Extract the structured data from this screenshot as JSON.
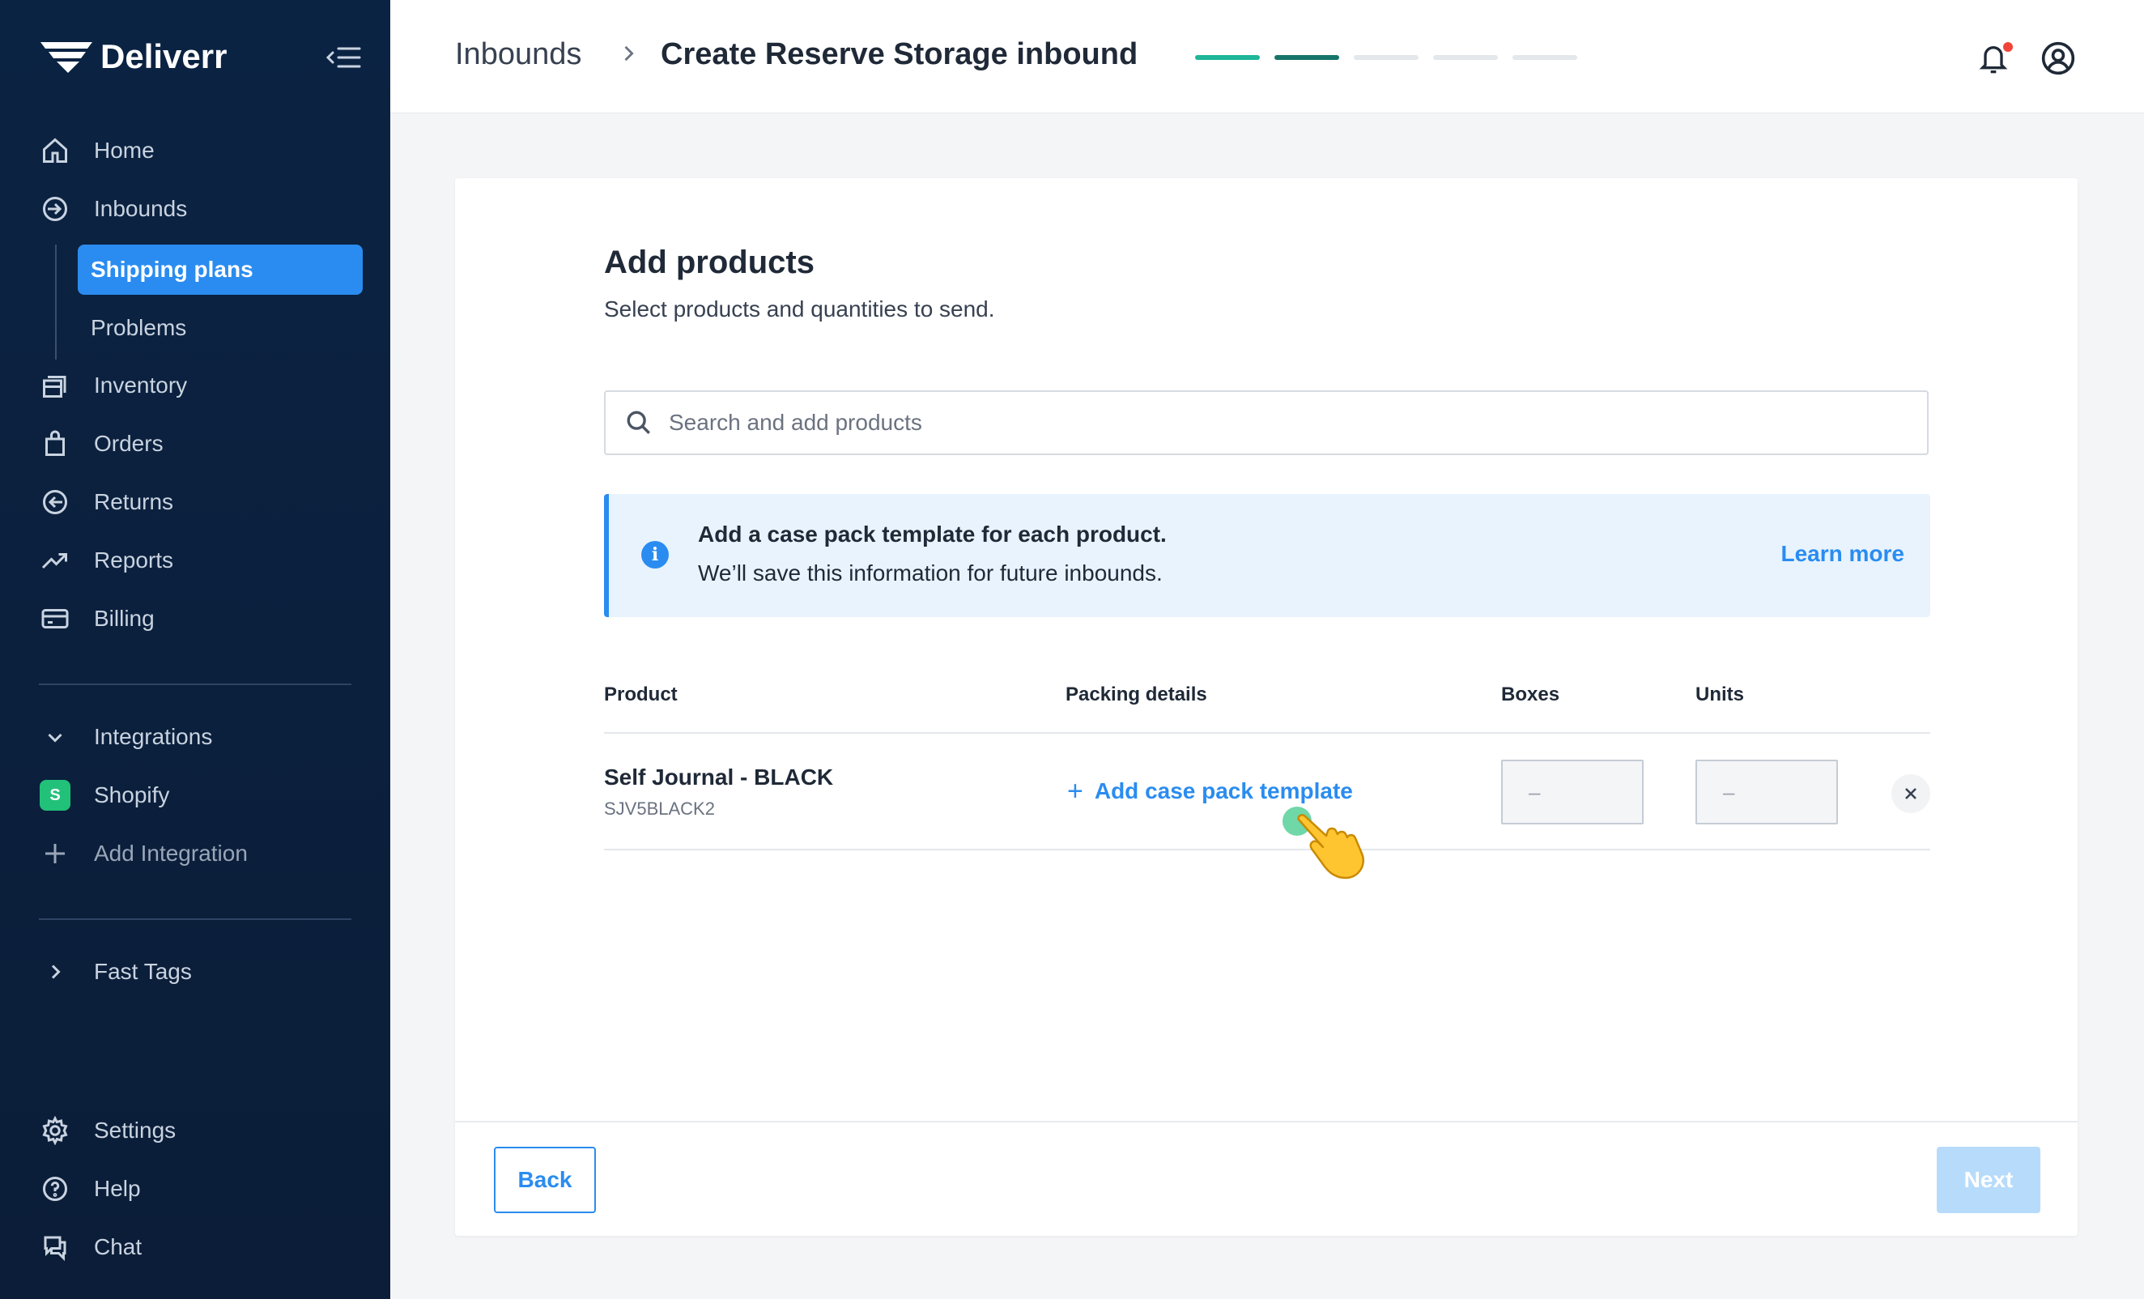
{
  "brand": {
    "name": "Deliverr"
  },
  "sidebar": {
    "items": [
      {
        "label": "Home",
        "icon": "home-icon"
      },
      {
        "label": "Inbounds",
        "icon": "inbound-arrow-icon"
      },
      {
        "label": "Inventory",
        "icon": "inventory-icon"
      },
      {
        "label": "Orders",
        "icon": "shopping-bag-icon"
      },
      {
        "label": "Returns",
        "icon": "return-arrow-icon"
      },
      {
        "label": "Reports",
        "icon": "trend-up-icon"
      },
      {
        "label": "Billing",
        "icon": "credit-card-icon"
      }
    ],
    "inbound_sub": [
      {
        "label": "Shipping plans",
        "active": true
      },
      {
        "label": "Problems",
        "active": false
      }
    ],
    "integrations": {
      "label": "Integrations",
      "shopify": "Shopify",
      "add": "Add Integration"
    },
    "fast_tags": "Fast Tags",
    "bottom": [
      {
        "label": "Settings",
        "icon": "gear-icon"
      },
      {
        "label": "Help",
        "icon": "help-icon"
      },
      {
        "label": "Chat",
        "icon": "chat-icon"
      }
    ]
  },
  "header": {
    "breadcrumb_parent": "Inbounds",
    "title": "Create Reserve Storage inbound",
    "steps_total": 5,
    "steps_done": 2
  },
  "main": {
    "title": "Add products",
    "subtitle": "Select products and quantities to send.",
    "search_placeholder": "Search and add products",
    "info": {
      "title": "Add a case pack template for each product.",
      "text": "We’ll save this information for future inbounds.",
      "link": "Learn more"
    },
    "table": {
      "headers": [
        "Product",
        "Packing details",
        "Boxes",
        "Units"
      ],
      "rows": [
        {
          "name": "Self Journal - BLACK",
          "sku": "SJV5BLACK2",
          "packing_action": "Add case pack template",
          "boxes": "–",
          "units": "–"
        }
      ]
    },
    "back_label": "Back",
    "next_label": "Next"
  },
  "colors": {
    "sidebar_bg": "#0b2342",
    "accent": "#2a8cf0",
    "step_done_1": "#1fb69a",
    "step_done_2": "#16756b",
    "info_bg": "#e8f3fd",
    "next_disabled": "#b7dbfb"
  }
}
